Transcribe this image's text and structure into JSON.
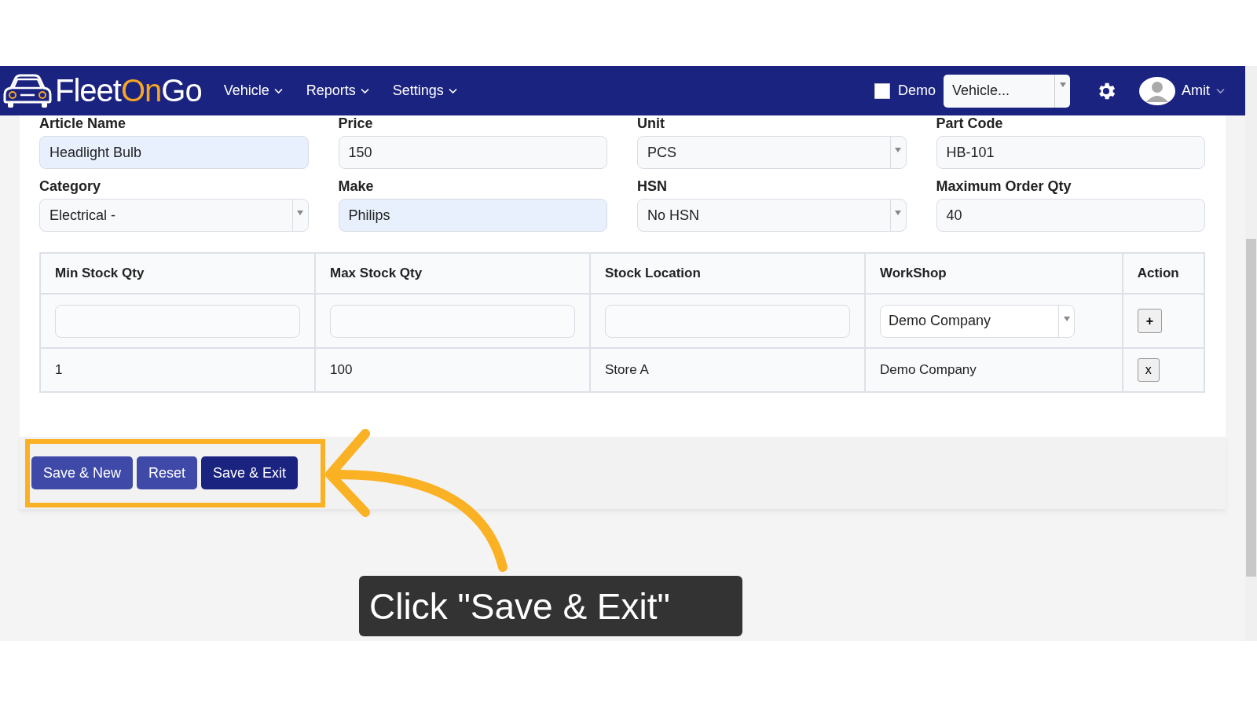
{
  "navbar": {
    "logo": [
      {
        "text": "Fleet",
        "accent": false
      },
      {
        "text": "On",
        "accent": true
      },
      {
        "text": "Go",
        "accent": false
      }
    ],
    "menu": [
      {
        "label": "Vehicle"
      },
      {
        "label": "Reports"
      },
      {
        "label": "Settings"
      }
    ],
    "demo": {
      "label": "Demo",
      "checked": false
    },
    "vehicle_select": {
      "value": "Vehicle..."
    },
    "user": {
      "name": "Amit"
    }
  },
  "form": {
    "fields": [
      {
        "label": "Article Name",
        "value": "Headlight Bulb",
        "kind": "text",
        "autofilled": true
      },
      {
        "label": "Price",
        "value": "150",
        "kind": "text",
        "autofilled": false
      },
      {
        "label": "Unit",
        "value": "PCS",
        "kind": "select",
        "autofilled": false
      },
      {
        "label": "Part Code",
        "value": "HB-101",
        "kind": "text",
        "autofilled": false
      },
      {
        "label": "Category",
        "value": "Electrical -",
        "kind": "select",
        "autofilled": false
      },
      {
        "label": "Make",
        "value": "Philips",
        "kind": "text",
        "autofilled": true
      },
      {
        "label": "HSN",
        "value": "No HSN",
        "kind": "select",
        "autofilled": false
      },
      {
        "label": "Maximum Order Qty",
        "value": "40",
        "kind": "text",
        "autofilled": false
      }
    ]
  },
  "stock_table": {
    "columns": [
      "Min Stock Qty",
      "Max Stock Qty",
      "Stock Location",
      "WorkShop",
      "Action"
    ],
    "input_row": [
      {
        "kind": "input"
      },
      {
        "kind": "input"
      },
      {
        "kind": "input"
      },
      {
        "kind": "select",
        "value": "Demo Company"
      },
      {
        "kind": "button",
        "value": "+"
      }
    ],
    "rows": [
      {
        "cells": [
          "1",
          "100",
          "Store A",
          "Demo Company"
        ],
        "action": "x"
      }
    ]
  },
  "buttons": [
    {
      "label": "Save & New",
      "primary": false
    },
    {
      "label": "Reset",
      "primary": false
    },
    {
      "label": "Save & Exit",
      "primary": true
    }
  ],
  "callout": {
    "text": "Click \"Save & Exit\""
  }
}
